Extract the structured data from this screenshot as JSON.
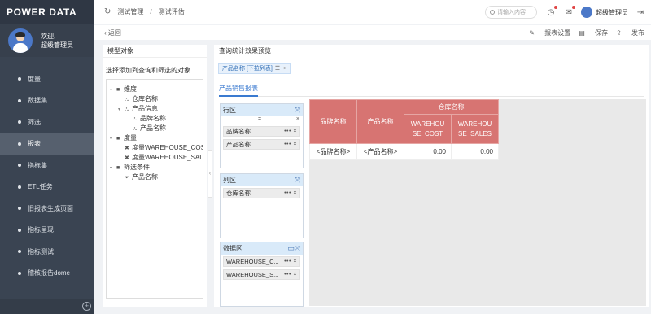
{
  "app": {
    "logo": "POWER DATA"
  },
  "user": {
    "greeting": "欢迎,",
    "name": "超级管理员"
  },
  "sidebar": {
    "items": [
      {
        "label": "度量"
      },
      {
        "label": "数据集"
      },
      {
        "label": "筛选"
      },
      {
        "label": "报表"
      },
      {
        "label": "指标集"
      },
      {
        "label": "ETL任务"
      },
      {
        "label": "旧报表生成页面"
      },
      {
        "label": "指标呈现"
      },
      {
        "label": "指标测试"
      },
      {
        "label": "稽核报告dome"
      }
    ],
    "active_index": 3
  },
  "topbar": {
    "breadcrumbs": [
      "测试管理",
      "测试评估"
    ],
    "search_placeholder": "请输入内容",
    "username": "超级管理员"
  },
  "subbar": {
    "back": "返回",
    "actions": [
      "报表设置",
      "保存",
      "发布"
    ]
  },
  "left_panel": {
    "title": "模型对象",
    "hint": "选择添加到查询和筛选的对象",
    "tree": [
      {
        "label": "维度",
        "depth": 0,
        "icon": "folder-icon",
        "toggle": "▾"
      },
      {
        "label": "仓库名称",
        "depth": 1,
        "icon": "hierarchy-icon",
        "toggle": ""
      },
      {
        "label": "产品信息",
        "depth": 1,
        "icon": "hierarchy-icon",
        "toggle": "▾"
      },
      {
        "label": "品牌名称",
        "depth": 2,
        "icon": "hierarchy-icon",
        "toggle": ""
      },
      {
        "label": "产品名称",
        "depth": 2,
        "icon": "hierarchy-icon",
        "toggle": ""
      },
      {
        "label": "度量",
        "depth": 0,
        "icon": "folder-icon",
        "toggle": "▾"
      },
      {
        "label": "度量WAREHOUSE_COST",
        "depth": 1,
        "icon": "measure-icon",
        "toggle": ""
      },
      {
        "label": "度量WAREHOUSE_SALES",
        "depth": 1,
        "icon": "measure-icon",
        "toggle": ""
      },
      {
        "label": "筛选条件",
        "depth": 0,
        "icon": "folder-icon",
        "toggle": "▾"
      },
      {
        "label": "产品名称",
        "depth": 1,
        "icon": "filter-icon",
        "toggle": ""
      }
    ]
  },
  "right_panel": {
    "title": "查询统计效果预览",
    "filter_chip": "产品名称 [下拉列表]",
    "tab": "产品销售报表",
    "row_zone": {
      "title": "行区",
      "eq": "=",
      "fields": [
        "品牌名称",
        "产品名称"
      ]
    },
    "col_zone": {
      "title": "列区",
      "fields": [
        "仓库名称"
      ]
    },
    "data_zone": {
      "title": "数据区",
      "fields": [
        "WAREHOUSE_C...",
        "WAREHOUSE_S..."
      ]
    },
    "field_ops": "•••",
    "pivot": {
      "header_brand": "品牌名称",
      "header_product": "产品名称",
      "header_group": "仓库名称",
      "header_cost": "WAREHOUSE_COST",
      "header_sales": "WAREHOUSE_SALES",
      "row": {
        "brand": "<品牌名称>",
        "product": "<产品名称>",
        "cost": "0.00",
        "sales": "0.00"
      }
    }
  },
  "colors": {
    "sidebar_bg": "#3a4452",
    "accent": "#3a7ad0",
    "pivot_header": "#d77472"
  }
}
